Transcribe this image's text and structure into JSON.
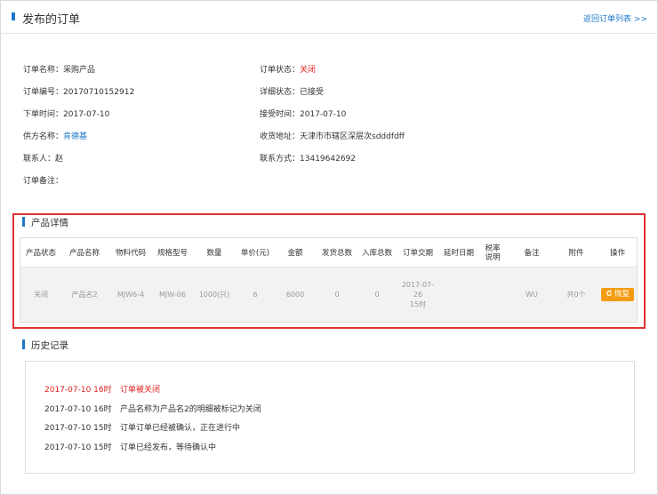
{
  "header": {
    "title": "发布的订单",
    "back_link": "返回订单列表 >>"
  },
  "order_info": {
    "left": [
      {
        "label": "订单名称：",
        "value": "采购产品"
      },
      {
        "label": "订单编号：",
        "value": "20170710152912"
      },
      {
        "label": "下单时间：",
        "value": "2017-07-10"
      },
      {
        "label": "供方名称：",
        "value": "肯德基"
      },
      {
        "label": "联系人：",
        "value": "赵"
      },
      {
        "label": "订单备注：",
        "value": ""
      }
    ],
    "right": [
      {
        "label": "订单状态：",
        "value": "关闭"
      },
      {
        "label": "详细状态：",
        "value": "已接受"
      },
      {
        "label": "接受时间：",
        "value": "2017-07-10"
      },
      {
        "label": "收货地址：",
        "value": "天津市市辖区深层次sdddfdff"
      },
      {
        "label": "联系方式：",
        "value": "13419642692"
      }
    ]
  },
  "product_section": {
    "title": "产品详情",
    "columns": [
      "产品状态",
      "产品名称",
      "物料代码",
      "规格型号",
      "数量",
      "单价(元)",
      "金额",
      "发货总数",
      "入库总数",
      "订单交期",
      "延时日期",
      "税率说明",
      "备注",
      "附件",
      "操作"
    ],
    "rows": [
      {
        "status": "关闭",
        "name": "产品名2",
        "code": "MJW6-4",
        "spec": "MJW-06",
        "qty": "1000(只)",
        "price": "6",
        "amount": "6000",
        "shipped": "0",
        "stocked": "0",
        "delivery_date": "2017-07-26",
        "delivery_time": "15时",
        "delay_date": "",
        "tax_note": "",
        "remark": "WU",
        "attachment": "共0个",
        "action": "恢复"
      }
    ]
  },
  "history_section": {
    "title": "历史记录",
    "entries": [
      {
        "time": "2017-07-10 16时",
        "text": "订单被关闭",
        "highlight": true
      },
      {
        "time": "2017-07-10 16时",
        "text": "产品名称为产品名2的明细被标记为关闭",
        "highlight": false
      },
      {
        "time": "2017-07-10 15时",
        "text": "订单订单已经被确认，正在进行中",
        "highlight": false
      },
      {
        "time": "2017-07-10 15时",
        "text": "订单已经发布，等待确认中",
        "highlight": false
      }
    ]
  },
  "colors": {
    "accent": "#1e78c8",
    "status_red": "#e02020",
    "highlight_box": "#e03131",
    "action_orange": "#f39c12"
  },
  "icons": {
    "restore": "refresh-icon"
  }
}
